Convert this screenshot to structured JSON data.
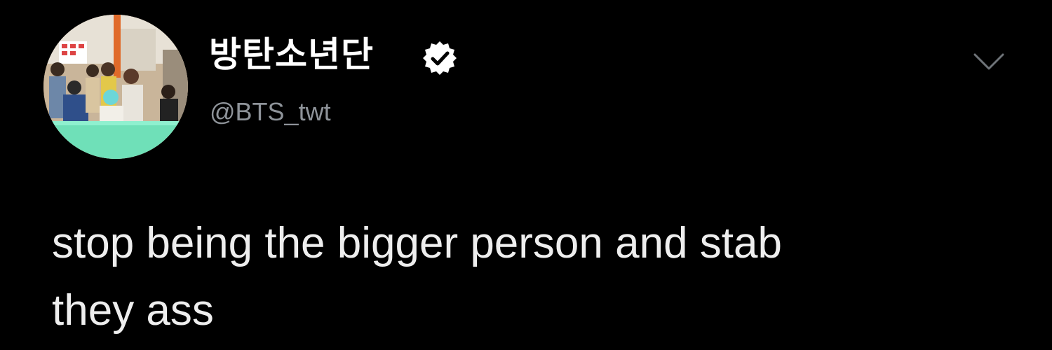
{
  "tweet": {
    "author": {
      "display_name": "방탄소년단",
      "handle": "@BTS_twt",
      "verified": true,
      "avatar_icon": "avatar-image"
    },
    "more_icon": "chevron-down-icon",
    "text_lines": [
      "stop being the bigger person and stab",
      "they ass"
    ]
  },
  "colors": {
    "background": "#000000",
    "text": "#eeeeee",
    "handle": "#8e9399",
    "avatar_counter": "#6fe0b8"
  }
}
